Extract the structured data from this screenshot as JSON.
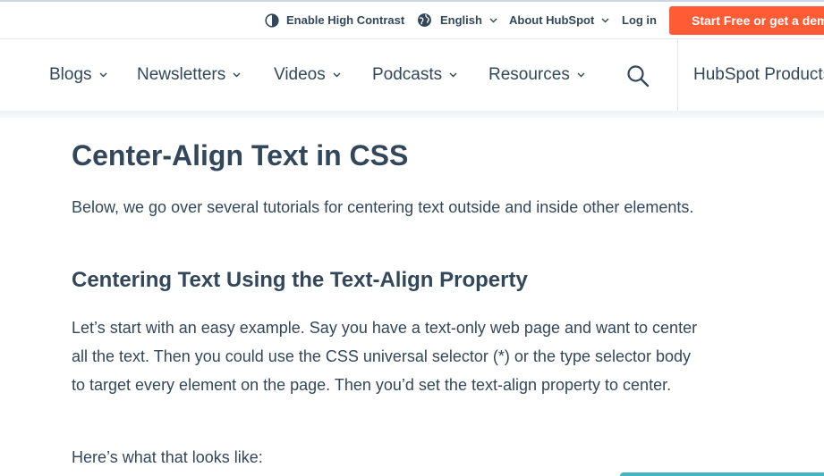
{
  "utility": {
    "contrast_label": "Enable High Contrast",
    "language_label": "English",
    "about_label": "About HubSpot",
    "login_label": "Log in",
    "cta_label": "Start Free or get a demo"
  },
  "nav": {
    "items": [
      {
        "label": "Blogs"
      },
      {
        "label": "Newsletters"
      },
      {
        "label": "Videos"
      },
      {
        "label": "Podcasts"
      },
      {
        "label": "Resources"
      }
    ],
    "products_label": "HubSpot Products"
  },
  "article": {
    "title": "Center-Align Text in CSS",
    "intro": "Below, we go over several tutorials for centering text outside and inside other elements.",
    "section_heading": "Centering Text Using the Text-Align Property",
    "paragraph": "Let’s start with an easy example. Say you have a text-only web page and want to center all the text. Then you could use the CSS universal selector (*) or the type selector body to target every element on the page. Then you’d set the text-align property to center.",
    "lead_in": "Here’s what that looks like:"
  },
  "colors": {
    "text": "#33475b",
    "cta": "#ff5c35",
    "code_block_accent": "#45b4c5"
  }
}
